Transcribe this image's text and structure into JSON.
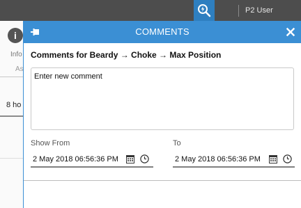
{
  "topbar": {
    "user_label": "P2 User",
    "search_icon": "search-lightning-icon",
    "accent": "#2e7fc0",
    "background": "#4d4d4d"
  },
  "background": {
    "info_text": "Info",
    "info_sub": "As",
    "hours_text": "8 ho"
  },
  "panel": {
    "title": "COMMENTS",
    "header_color": "#3b8fd4",
    "heading": "Comments for Beardy → Choke → Max Position",
    "comment_placeholder": "Enter new comment",
    "show_from_label": "Show From",
    "to_label": "To",
    "show_from_value": "2 May 2018 06:56:36 PM",
    "to_value": "2 May 2018 06:56:36 PM",
    "icons": {
      "pin": "pin-icon",
      "close": "close-icon",
      "calendar": "calendar-icon",
      "clock": "clock-icon"
    }
  }
}
